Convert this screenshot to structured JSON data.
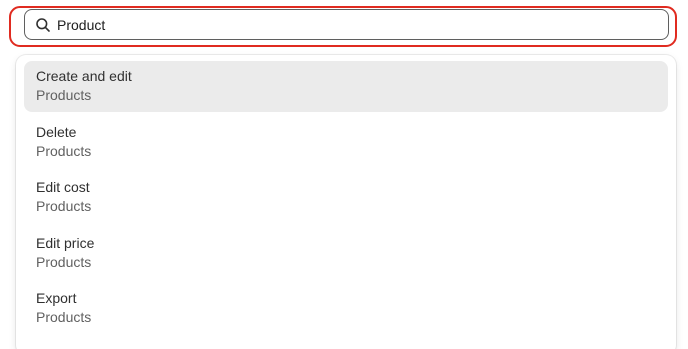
{
  "search": {
    "value": "Product",
    "icon": "search-icon"
  },
  "highlight_color": "#e02b20",
  "results": [
    {
      "title": "Create and edit",
      "subtitle": "Products",
      "active": true
    },
    {
      "title": "Delete",
      "subtitle": "Products",
      "active": false
    },
    {
      "title": "Edit cost",
      "subtitle": "Products",
      "active": false
    },
    {
      "title": "Edit price",
      "subtitle": "Products",
      "active": false
    },
    {
      "title": "Export",
      "subtitle": "Products",
      "active": false
    }
  ]
}
